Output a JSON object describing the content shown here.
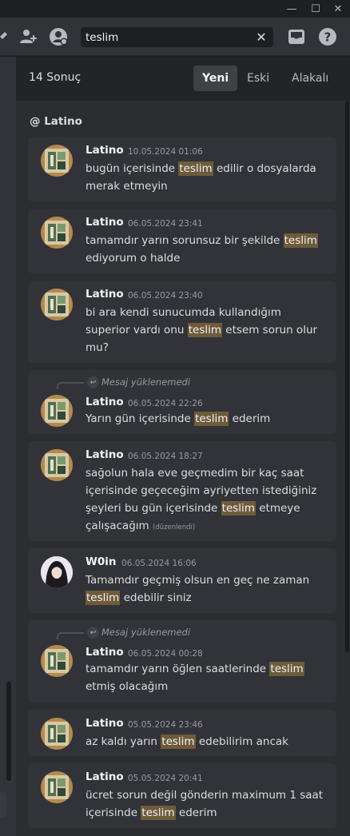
{
  "window": {
    "minimize_glyph": "—",
    "maximize_glyph": "☐",
    "close_glyph": "✕"
  },
  "toolbar": {
    "icons": [
      "pin-icon",
      "add-friend-icon",
      "user-profile-icon",
      "inbox-icon",
      "help-icon"
    ],
    "help_glyph": "?",
    "search": {
      "value": "teslim",
      "clear_glyph": "✕"
    }
  },
  "results": {
    "count_label": "14 Sonuç",
    "sort_tabs": [
      {
        "label": "Yeni",
        "active": true
      },
      {
        "label": "Eski",
        "active": false
      },
      {
        "label": "Alakalı",
        "active": false
      }
    ],
    "channel": "@ Latino",
    "highlight_color": "#6e5b3a",
    "messages": [
      {
        "author": "Latino",
        "timestamp": "10.05.2024 01:06",
        "reply": null,
        "before": "bugün içerisinde ",
        "match": "teslim",
        "after": " edilir o dosyalarda merak etmeyin",
        "edited": ""
      },
      {
        "author": "Latino",
        "timestamp": "06.05.2024 23:41",
        "reply": null,
        "before": "tamamdır yarın sorunsuz bir şekilde ",
        "match": "teslim",
        "after": " ediyorum o halde",
        "edited": ""
      },
      {
        "author": "Latino",
        "timestamp": "06.05.2024 23:40",
        "reply": null,
        "before": "bi ara kendi sunucumda kullandığım superior vardı onu ",
        "match": "teslim",
        "after": " etsem sorun olur mu?",
        "edited": ""
      },
      {
        "author": "Latino",
        "timestamp": "06.05.2024 22:26",
        "reply": "Mesaj yüklenemedi",
        "before": "Yarın gün içerisinde ",
        "match": "teslim",
        "after": " ederim",
        "edited": ""
      },
      {
        "author": "Latino",
        "timestamp": "06.05.2024 18:27",
        "reply": null,
        "before": "sağolun hala eve geçmedim bir kaç saat içerisinde geçeceğim ayriyetten istediğiniz şeyleri bu gün içerisinde ",
        "match": "teslim",
        "after": " etmeye çalışacağım",
        "edited": "(düzenlendi)"
      },
      {
        "author": "W0in",
        "timestamp": "06.05.2024 16:06",
        "reply": null,
        "before": "Tamamdır geçmiş olsun en geç ne zaman ",
        "match": "teslim",
        "after": " edebilir siniz",
        "edited": ""
      },
      {
        "author": "Latino",
        "timestamp": "06.05.2024 00:28",
        "reply": "Mesaj yüklenemedi",
        "before": "tamamdır yarın öğlen saatlerinde ",
        "match": "teslim",
        "after": " etmiş olacağım",
        "edited": ""
      },
      {
        "author": "Latino",
        "timestamp": "05.05.2024 23:46",
        "reply": null,
        "before": "az kaldı yarın ",
        "match": "teslim",
        "after": " edebilirim ancak",
        "edited": ""
      },
      {
        "author": "Latino",
        "timestamp": "05.05.2024 20:41",
        "reply": null,
        "before": "ücret sorun değil gönderin maximum 1 saat içerisinde ",
        "match": "teslim",
        "after": " ederim",
        "edited": ""
      }
    ]
  }
}
